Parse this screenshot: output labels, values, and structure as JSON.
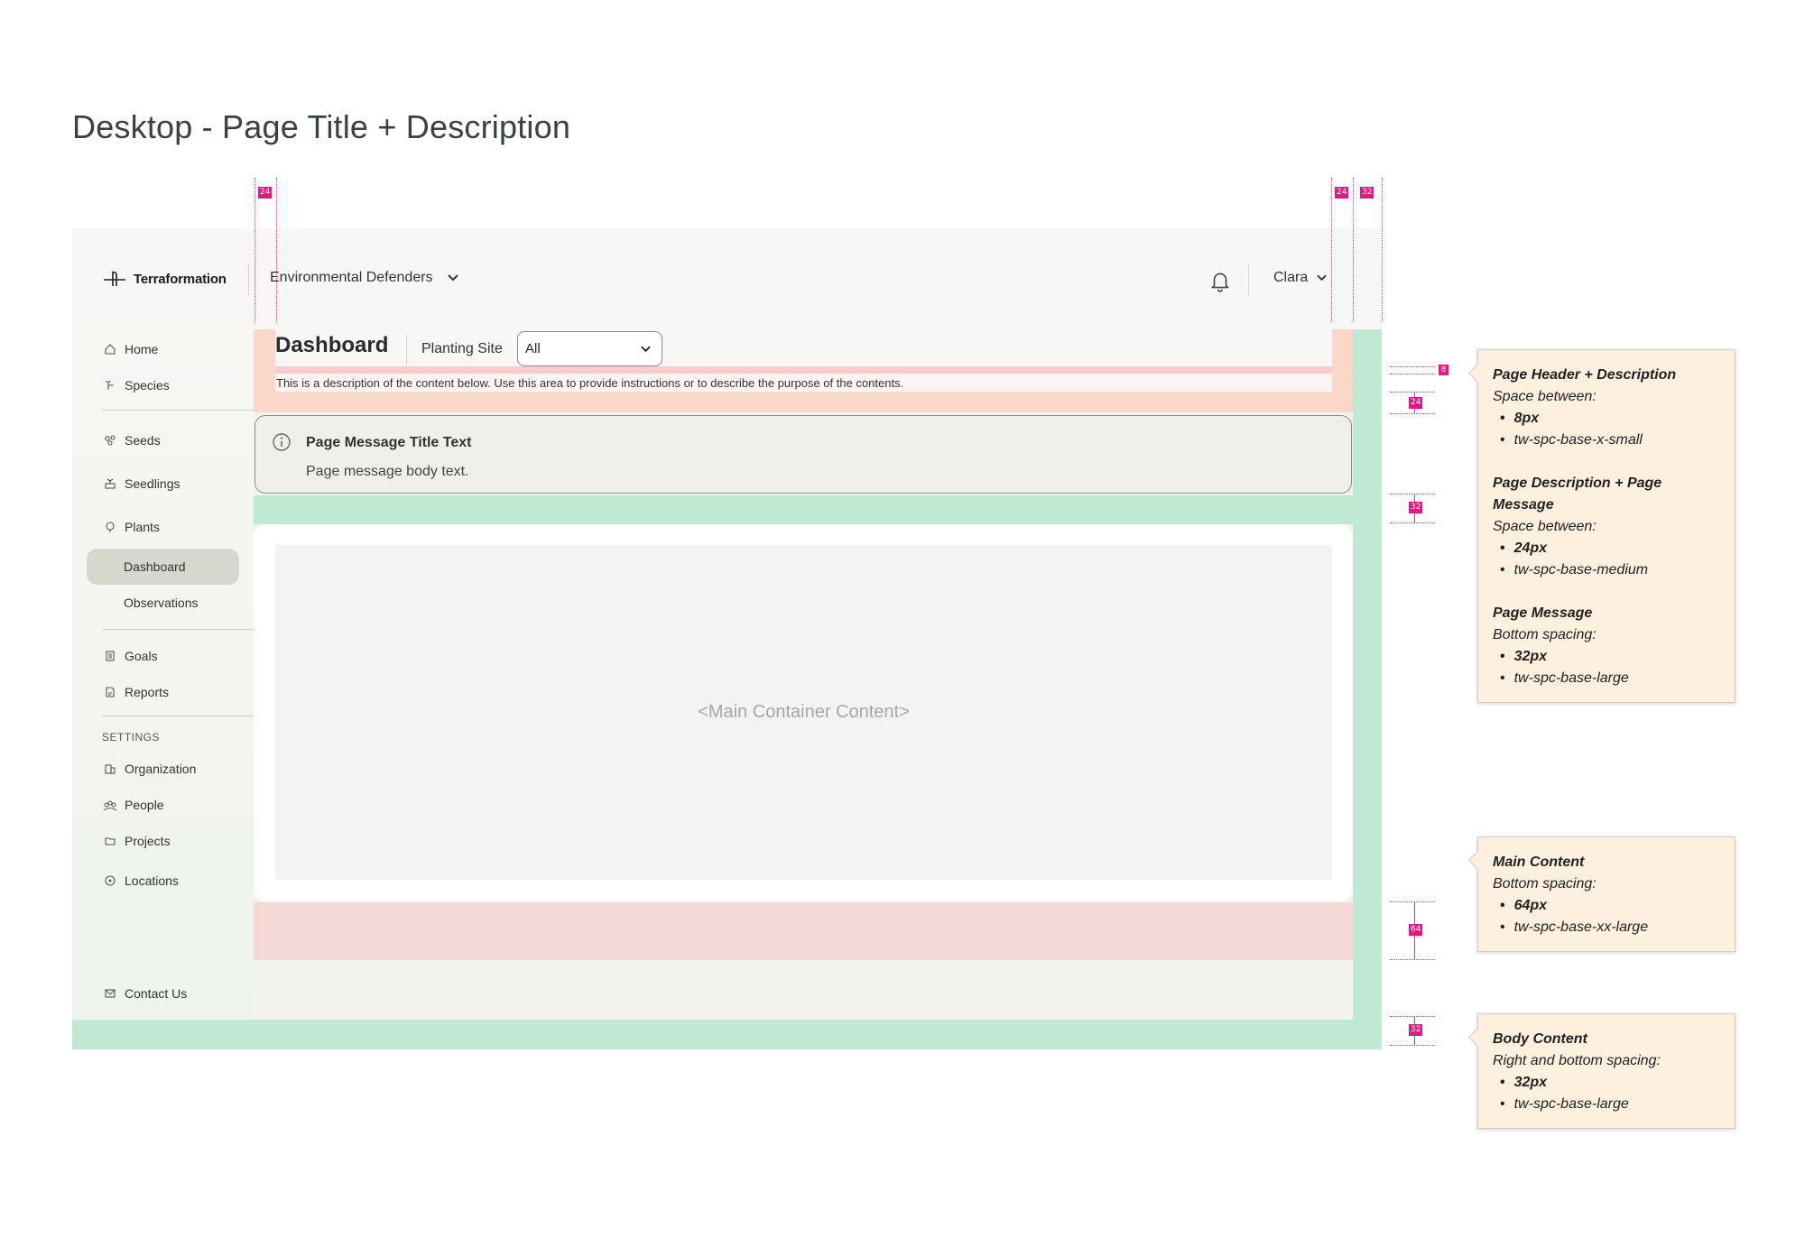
{
  "heading": "Desktop - Page Title + Description",
  "topbar": {
    "logo_text": "Terraformation",
    "org_name": "Environmental Defenders",
    "user_name": "Clara"
  },
  "sidebar": {
    "items": [
      {
        "label": "Home",
        "icon": "home-icon"
      },
      {
        "label": "Species",
        "icon": "species-icon"
      },
      {
        "label": "Seeds",
        "icon": "seeds-icon"
      },
      {
        "label": "Seedlings",
        "icon": "seedlings-icon"
      },
      {
        "label": "Plants",
        "icon": "plants-icon"
      },
      {
        "label": "Dashboard"
      },
      {
        "label": "Observations"
      },
      {
        "label": "Goals",
        "icon": "goals-icon"
      },
      {
        "label": "Reports",
        "icon": "reports-icon"
      },
      {
        "label": "Organization",
        "icon": "organization-icon"
      },
      {
        "label": "People",
        "icon": "people-icon"
      },
      {
        "label": "Projects",
        "icon": "projects-icon"
      },
      {
        "label": "Locations",
        "icon": "locations-icon"
      },
      {
        "label": "Contact Us",
        "icon": "mail-icon"
      }
    ],
    "settings_label": "SETTINGS"
  },
  "page": {
    "title": "Dashboard",
    "planting_site_label": "Planting Site",
    "planting_site_value": "All",
    "description": "This is a description of the content below. Use this area to provide instructions or to describe the purpose of the contents."
  },
  "message": {
    "title": "Page Message Title Text",
    "body": "Page message body text."
  },
  "main_placeholder": "<Main Container Content>",
  "measurements": {
    "left_gap": "24",
    "right_gap": "24",
    "right_outer": "32",
    "header_desc": "8",
    "desc_message": "24",
    "message_bottom": "32",
    "main_bottom": "64",
    "body_bottom": "32"
  },
  "notes": {
    "header": {
      "title1": "Page Header + Description",
      "sub1": "Space between:",
      "b1a": "8px",
      "b1b": "tw-spc-base-x-small",
      "title2": "Page Description + Page Message",
      "sub2": "Space between:",
      "b2a": "24px",
      "b2b": "tw-spc-base-medium",
      "title3": "Page Message",
      "sub3": "Bottom spacing:",
      "b3a": "32px",
      "b3b": "tw-spc-base-large"
    },
    "main": {
      "title": "Main Content",
      "sub": "Bottom spacing:",
      "ba": "64px",
      "bb": "tw-spc-base-xx-large"
    },
    "body": {
      "title": "Body Content",
      "sub": "Right and bottom spacing:",
      "ba": "32px",
      "bb": "tw-spc-base-large"
    }
  },
  "colors": {
    "header_band": "#f9d8c9",
    "spacing_green": "#c0e9d4",
    "bottom_band": "#f4d9d7",
    "guide_pink": "#e8177d",
    "note_bg": "#fdf0de"
  }
}
